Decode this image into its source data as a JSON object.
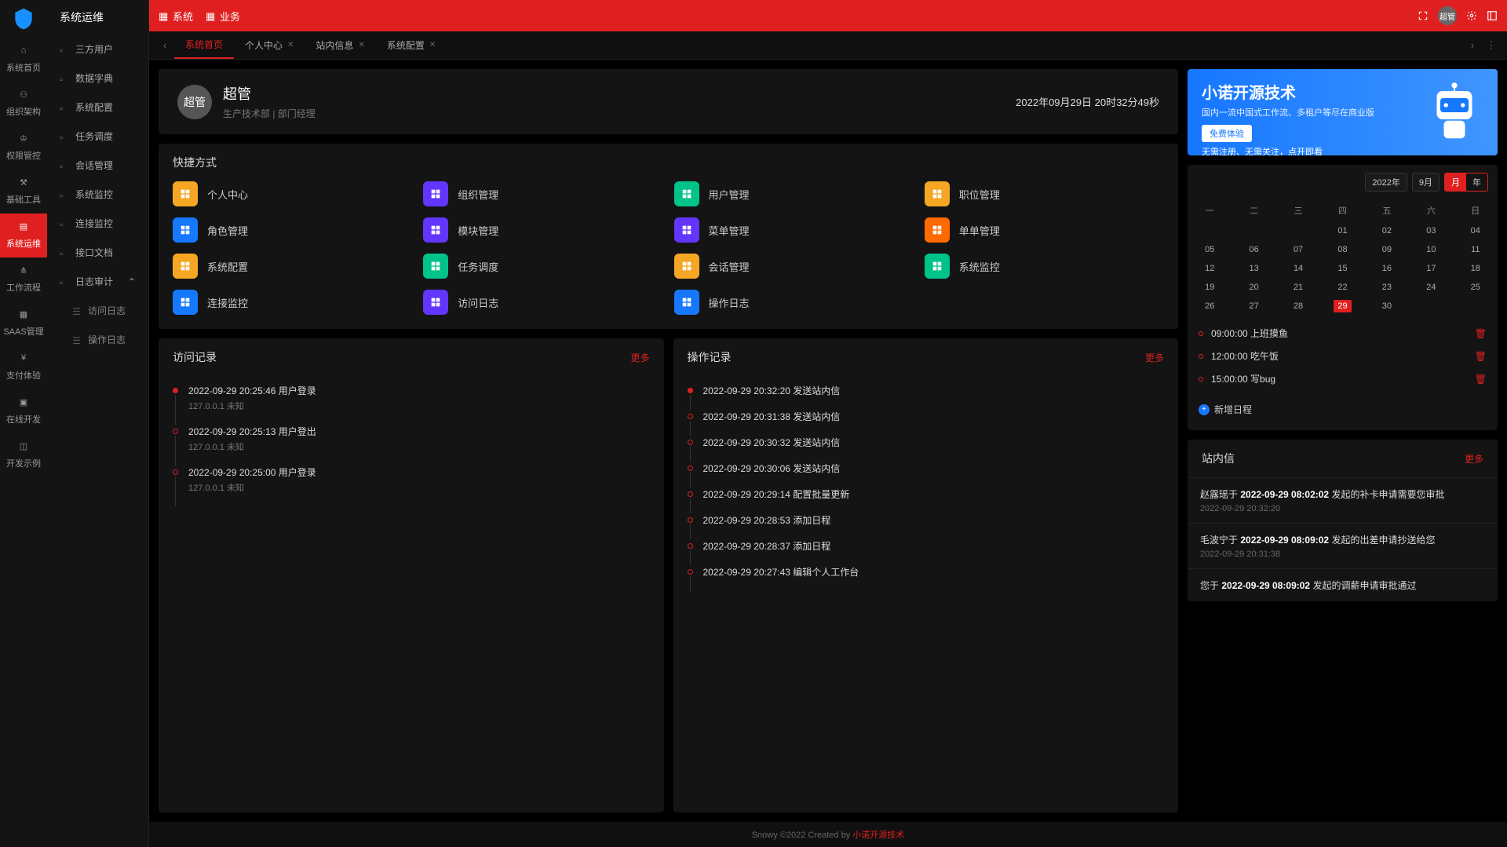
{
  "sidebarTitle": "系统运维",
  "primaryNav": [
    {
      "label": "系统首页"
    },
    {
      "label": "组织架构"
    },
    {
      "label": "权限管控"
    },
    {
      "label": "基础工具"
    },
    {
      "label": "系统运维"
    },
    {
      "label": "工作流程"
    },
    {
      "label": "SAAS管理"
    },
    {
      "label": "支付体验"
    },
    {
      "label": "在线开发"
    },
    {
      "label": "开发示例"
    }
  ],
  "secondaryMenu": [
    {
      "label": "三方用户"
    },
    {
      "label": "数据字典"
    },
    {
      "label": "系统配置"
    },
    {
      "label": "任务调度"
    },
    {
      "label": "会话管理"
    },
    {
      "label": "系统监控"
    },
    {
      "label": "连接监控"
    },
    {
      "label": "接口文档"
    },
    {
      "label": "日志审计"
    }
  ],
  "submenu": [
    {
      "label": "访问日志"
    },
    {
      "label": "操作日志"
    }
  ],
  "topbar": {
    "items": [
      {
        "label": "系统"
      },
      {
        "label": "业务"
      }
    ],
    "avatar": "超管"
  },
  "tabs": [
    {
      "label": "系统首页",
      "closable": false,
      "active": true
    },
    {
      "label": "个人中心",
      "closable": true
    },
    {
      "label": "站内信息",
      "closable": true
    },
    {
      "label": "系统配置",
      "closable": true
    }
  ],
  "user": {
    "avatar": "超管",
    "name": "超管",
    "dept": "生产技术部 | 部门经理",
    "time": "2022年09月29日 20时32分49秒"
  },
  "shortcutsTitle": "快捷方式",
  "shortcuts": [
    {
      "label": "个人中心",
      "color": "#f5a623"
    },
    {
      "label": "组织管理",
      "color": "#6236ff"
    },
    {
      "label": "用户管理",
      "color": "#00c389"
    },
    {
      "label": "职位管理",
      "color": "#f5a623"
    },
    {
      "label": "角色管理",
      "color": "#1677ff"
    },
    {
      "label": "模块管理",
      "color": "#6236ff"
    },
    {
      "label": "菜单管理",
      "color": "#6236ff"
    },
    {
      "label": "单单管理",
      "color": "#ff6a00"
    },
    {
      "label": "系统配置",
      "color": "#f5a623"
    },
    {
      "label": "任务调度",
      "color": "#00c389"
    },
    {
      "label": "会话管理",
      "color": "#f5a623"
    },
    {
      "label": "系统监控",
      "color": "#00c389"
    },
    {
      "label": "连接监控",
      "color": "#1677ff"
    },
    {
      "label": "访问日志",
      "color": "#6236ff"
    },
    {
      "label": "操作日志",
      "color": "#1677ff"
    }
  ],
  "accessLog": {
    "title": "访问记录",
    "more": "更多",
    "items": [
      {
        "title": "2022-09-29 20:25:46 用户登录",
        "sub": "127.0.0.1 未知"
      },
      {
        "title": "2022-09-29 20:25:13 用户登出",
        "sub": "127.0.0.1 未知"
      },
      {
        "title": "2022-09-29 20:25:00 用户登录",
        "sub": "127.0.0.1 未知"
      }
    ]
  },
  "opLog": {
    "title": "操作记录",
    "more": "更多",
    "items": [
      {
        "title": "2022-09-29 20:32:20 发送站内信"
      },
      {
        "title": "2022-09-29 20:31:38 发送站内信"
      },
      {
        "title": "2022-09-29 20:30:32 发送站内信"
      },
      {
        "title": "2022-09-29 20:30:06 发送站内信"
      },
      {
        "title": "2022-09-29 20:29:14 配置批量更新"
      },
      {
        "title": "2022-09-29 20:28:53 添加日程"
      },
      {
        "title": "2022-09-29 20:28:37 添加日程"
      },
      {
        "title": "2022-09-29 20:27:43 编辑个人工作台"
      }
    ]
  },
  "banner": {
    "title": "小诺开源技术",
    "sub": "国内一流中国式工作流、多租户等尽在商业版",
    "btn": "免费体验",
    "note": "无需注册、无需关注，点开即看"
  },
  "calendar": {
    "year": "2022年",
    "month": "9月",
    "viewMonth": "月",
    "viewYear": "年",
    "weekdays": [
      "一",
      "二",
      "三",
      "四",
      "五",
      "六",
      "日"
    ],
    "cells": [
      {
        "v": "",
        "dim": true
      },
      {
        "v": "",
        "dim": true
      },
      {
        "v": "",
        "dim": true
      },
      {
        "v": "01"
      },
      {
        "v": "02"
      },
      {
        "v": "03"
      },
      {
        "v": "04"
      },
      {
        "v": "05"
      },
      {
        "v": "06"
      },
      {
        "v": "07"
      },
      {
        "v": "08"
      },
      {
        "v": "09"
      },
      {
        "v": "10"
      },
      {
        "v": "11"
      },
      {
        "v": "12"
      },
      {
        "v": "13"
      },
      {
        "v": "14"
      },
      {
        "v": "15"
      },
      {
        "v": "16"
      },
      {
        "v": "17"
      },
      {
        "v": "18"
      },
      {
        "v": "19"
      },
      {
        "v": "20"
      },
      {
        "v": "21"
      },
      {
        "v": "22"
      },
      {
        "v": "23"
      },
      {
        "v": "24"
      },
      {
        "v": "25"
      },
      {
        "v": "26"
      },
      {
        "v": "27"
      },
      {
        "v": "28"
      },
      {
        "v": "29",
        "today": true
      },
      {
        "v": "30"
      },
      {
        "v": "",
        "dim": true
      },
      {
        "v": "",
        "dim": true
      }
    ],
    "events": [
      {
        "text": "09:00:00 上班摸鱼"
      },
      {
        "text": "12:00:00 吃午饭"
      },
      {
        "text": "15:00:00 写bug"
      }
    ],
    "addLabel": "新增日程"
  },
  "inbox": {
    "title": "站内信",
    "more": "更多",
    "items": [
      {
        "who": "赵露瑶",
        "bold": "2022-09-29 08:02:02",
        "rest": "发起的补卡申请需要您审批",
        "time": "2022-09-29 20:32:20"
      },
      {
        "who": "毛波宁",
        "bold": "2022-09-29 08:09:02",
        "rest": "发起的出差申请抄送给您",
        "time": "2022-09-29 20:31:38"
      },
      {
        "who": "您",
        "bold": "2022-09-29 08:09:02",
        "rest": "发起的调薪申请审批通过",
        "time": ""
      }
    ]
  },
  "footer": {
    "prefix": "Snowy ©2022 Created by ",
    "link": "小诺开源技术"
  }
}
